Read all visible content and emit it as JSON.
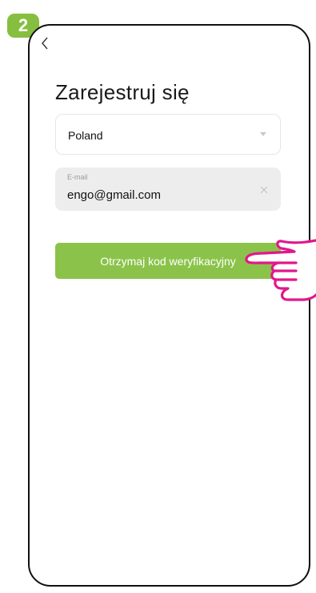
{
  "step": {
    "number": "2"
  },
  "header": {
    "back_icon": "chevron-left-icon",
    "title": "Zarejestruj się"
  },
  "form": {
    "country": {
      "value": "Poland",
      "icon": "chevron-down-icon"
    },
    "email": {
      "label": "E-mail",
      "value": "engo@gmail.com",
      "icon": "close-icon"
    },
    "submit_label": "Otrzymaj kod weryfikacyjny"
  },
  "colors": {
    "accent": "#8bc34a",
    "badge": "#86bf3f",
    "hand_outline": "#e0188c",
    "field_bg": "#ededed"
  }
}
